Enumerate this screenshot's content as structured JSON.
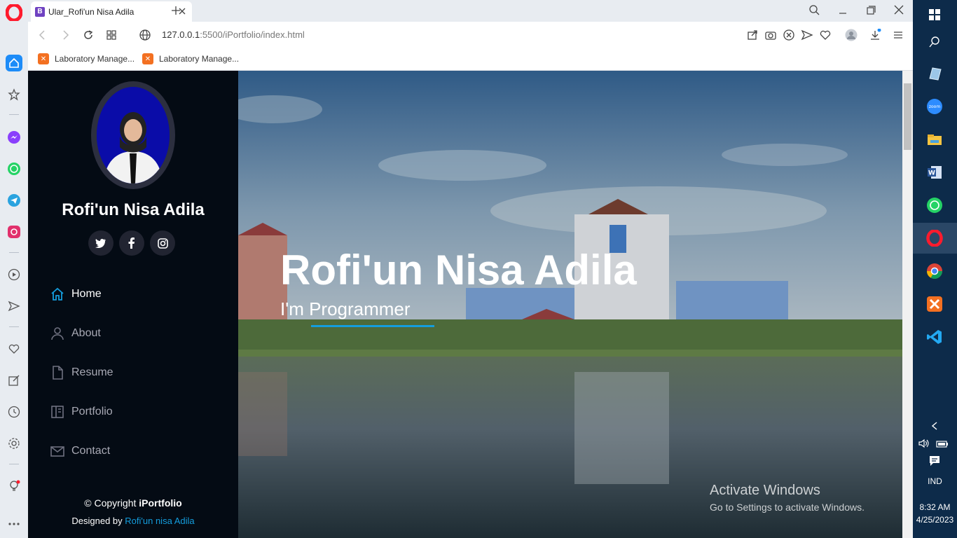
{
  "browser": {
    "tab_title": "Ular_Rofi'un Nisa Adila",
    "tab_favicon": "B",
    "url_host": "127.0.0.1",
    "url_path": ":5500/iPortfolio/index.html",
    "bookmarks": [
      "Laboratory Manage...",
      "Laboratory Manage..."
    ]
  },
  "sidebar": {
    "name": "Rofi'un Nisa Adila",
    "social": [
      "twitter-icon",
      "facebook-icon",
      "instagram-icon"
    ],
    "nav": [
      {
        "label": "Home",
        "icon": "home-icon",
        "active": true
      },
      {
        "label": "About",
        "icon": "user-icon",
        "active": false
      },
      {
        "label": "Resume",
        "icon": "file-icon",
        "active": false
      },
      {
        "label": "Portfolio",
        "icon": "portfolio-icon",
        "active": false
      },
      {
        "label": "Contact",
        "icon": "envelope-icon",
        "active": false
      }
    ],
    "copyright_prefix": "© Copyright ",
    "copyright_brand": "iPortfolio",
    "designed_prefix": "Designed by ",
    "designed_author": "Rofi'un nisa Adila"
  },
  "hero": {
    "title": "Rofi'un Nisa Adila",
    "subtitle": "I'm Programmer"
  },
  "watermark": {
    "line1": "Activate Windows",
    "line2": "Go to Settings to activate Windows."
  },
  "taskbar": {
    "lang": "IND",
    "time": "8:32 AM",
    "date": "4/25/2023"
  },
  "colors": {
    "accent": "#149ddd",
    "sidebar_bg": "#040b14"
  }
}
